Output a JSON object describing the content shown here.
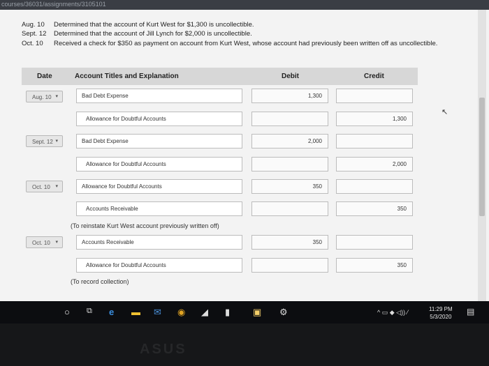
{
  "browser": {
    "url_fragment": "courses/36031/assignments/3105101"
  },
  "transactions": [
    {
      "date": "Aug. 10",
      "text": "Determined that the account of Kurt West for $1,300 is uncollectible."
    },
    {
      "date": "Sept. 12",
      "text": "Determined that the account of Jill Lynch for $2,000 is uncollectible."
    },
    {
      "date": "Oct. 10",
      "text": "Received a check for $350 as payment on account from Kurt West, whose account had previously been written off as uncollectible."
    }
  ],
  "table": {
    "headers": {
      "date": "Date",
      "account": "Account Titles and Explanation",
      "debit": "Debit",
      "credit": "Credit"
    },
    "rows": [
      {
        "date": "Aug. 10",
        "account": "Bad Debt Expense",
        "debit": "1,300",
        "credit": ""
      },
      {
        "date": "",
        "account": "Allowance for Doubtful Accounts",
        "debit": "",
        "credit": "1,300"
      },
      {
        "date": "Sept. 12",
        "account": "Bad Debt Expense",
        "debit": "2,000",
        "credit": ""
      },
      {
        "date": "",
        "account": "Allowance for Doubtful Accounts",
        "debit": "",
        "credit": "2,000"
      },
      {
        "date": "Oct. 10",
        "account": "Allowance for Doubtful Accounts",
        "debit": "350",
        "credit": ""
      },
      {
        "date": "",
        "account": "Accounts Receivable",
        "debit": "",
        "credit": "350"
      },
      {
        "date": "Oct. 10",
        "account": "Accounts Receivable",
        "debit": "350",
        "credit": ""
      },
      {
        "date": "",
        "account": "Allowance for Doubtful Accounts",
        "debit": "",
        "credit": "350"
      }
    ],
    "notes": [
      "(To reinstate Kurt West account previously written off)",
      "(To record collection)"
    ],
    "dropdown_arrow": "▾"
  },
  "taskbar": {
    "icons": [
      "start-search-icon",
      "task-view-icon",
      "edge-icon",
      "file-explorer-icon",
      "mail-icon",
      "chrome-icon",
      "app-icon",
      "app-icon-2",
      "store-icon",
      "settings-icon"
    ],
    "time": "11:29 PM",
    "date": "5/3/2020"
  },
  "bezel_logo": "ASUS"
}
